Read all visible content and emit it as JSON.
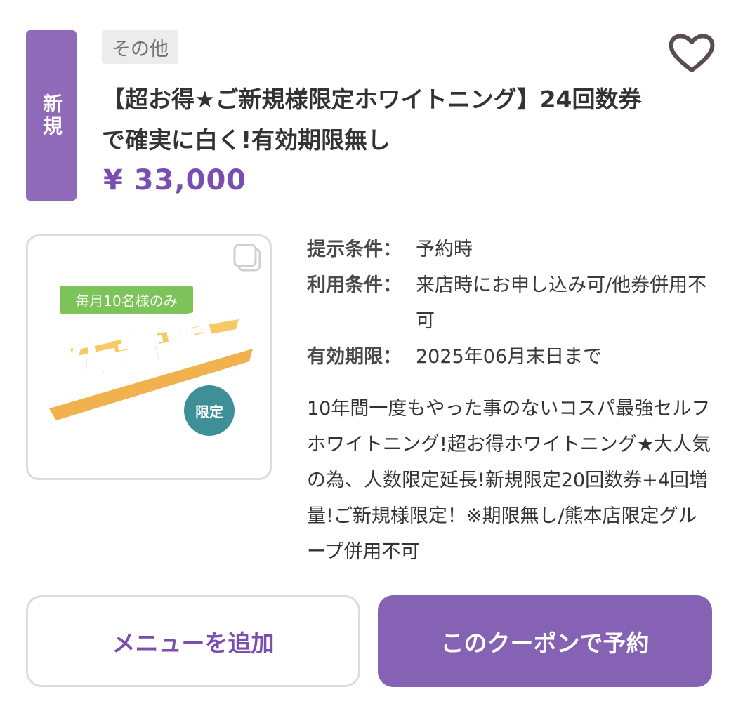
{
  "coupon": {
    "new_badge": "新規",
    "category": "その他",
    "title": "【超お得★ご新規様限定ホワイトニング】24回数券で確実に白く!有効期限無し",
    "price": "¥ 33,000"
  },
  "image": {
    "monthly_label": "毎月10名様のみ",
    "first_come": "先着順",
    "limited": "限定"
  },
  "conditions": [
    {
      "label": "提示条件：",
      "value": "予約時"
    },
    {
      "label": "利用条件：",
      "value": "来店時にお申し込み可/他券併用不可"
    },
    {
      "label": "有効期限：",
      "value": "2025年06月末日まで"
    }
  ],
  "description": "10年間一度もやった事のないコスパ最強セルフホワイトニング!超お得ホワイトニング★大人気の為、人数限定延長!新規限定20回数券+4回増量!ご新規様限定！※期限無し/熊本店限定グループ併用不可",
  "buttons": {
    "add_menu": "メニューを追加",
    "reserve": "このクーポンで予約"
  },
  "icons": {
    "favorite": "heart-outline-icon",
    "gallery": "gallery-stack-icon"
  },
  "colors": {
    "accent": "#8562b3",
    "price": "#7a4eb0",
    "badge": "#8e6ab8"
  }
}
